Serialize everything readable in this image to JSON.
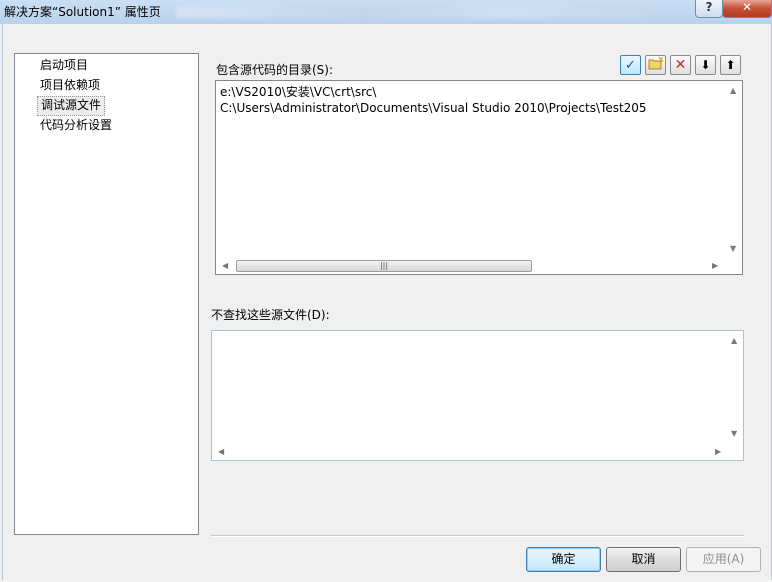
{
  "window": {
    "title": "解决方案“Solution1” 属性页",
    "help_label": "?",
    "close_label": "✕"
  },
  "tree": {
    "items": [
      {
        "label": "启动项目"
      },
      {
        "label": "项目依赖项"
      },
      {
        "label": "调试源文件",
        "selected": true
      },
      {
        "label": "代码分析设置"
      }
    ]
  },
  "source_dirs": {
    "label": "包含源代码的目录(S):",
    "paths": [
      "e:\\VS2010\\安装\\VC\\crt\\src\\",
      "C:\\Users\\Administrator\\Documents\\Visual Studio 2010\\Projects\\Test205"
    ],
    "toolbar": [
      {
        "name": "check-icon",
        "glyph": "✓"
      },
      {
        "name": "new-folder-icon",
        "glyph": "📁"
      },
      {
        "name": "delete-icon",
        "glyph": "✕"
      },
      {
        "name": "move-down-icon",
        "glyph": "⬇"
      },
      {
        "name": "move-up-icon",
        "glyph": "⬆"
      }
    ]
  },
  "exclude_files": {
    "label": "不查找这些源文件(D):"
  },
  "buttons": {
    "ok": "确定",
    "cancel": "取消",
    "apply": "应用(A)"
  },
  "colors": {
    "accent": "#3c7fb1",
    "delete_icon": "#c0261f",
    "check_icon": "#1c4f96"
  }
}
